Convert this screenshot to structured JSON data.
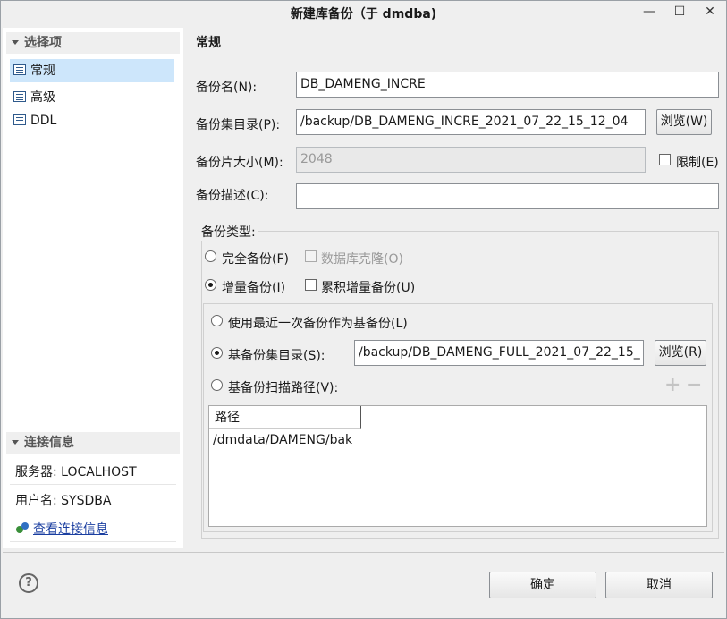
{
  "window": {
    "title": "新建库备份（于 dmdba)"
  },
  "nav": {
    "section_title": "选择项",
    "items": [
      {
        "label": "常规",
        "selected": true
      },
      {
        "label": "高级",
        "selected": false
      },
      {
        "label": "DDL",
        "selected": false
      }
    ]
  },
  "connection": {
    "section_title": "连接信息",
    "server": "服务器: LOCALHOST",
    "user": "用户名: SYSDBA",
    "view_link": "查看连接信息"
  },
  "main": {
    "heading": "常规",
    "backup_name_label": "备份名(N):",
    "backup_name_value": "DB_DAMENG_INCRE",
    "backup_dir_label": "备份集目录(P):",
    "backup_dir_value": "/backup/DB_DAMENG_INCRE_2021_07_22_15_12_04",
    "browse_label": "浏览(W)",
    "piece_size_label": "备份片大小(M):",
    "piece_size_value": "2048",
    "limit_label": "限制(E)",
    "desc_label": "备份描述(C):",
    "desc_value": ""
  },
  "backup_type": {
    "title": "备份类型:",
    "full_label": "完全备份(F)",
    "clone_label": "数据库克隆(O)",
    "incr_label": "增量备份(I)",
    "cumulative_label": "累积增量备份(U)",
    "selected": "incr"
  },
  "incremental": {
    "use_recent_label": "使用最近一次备份作为基备份(L)",
    "base_dir_label": "基备份集目录(S):",
    "base_dir_value": "/backup/DB_DAMENG_FULL_2021_07_22_15_",
    "browse_label": "浏览(R)",
    "scan_path_label": "基备份扫描路径(V):",
    "add_icon": "plus-icon",
    "remove_icon": "minus-icon",
    "column_header": "路径",
    "paths": [
      "/dmdata/DAMENG/bak"
    ]
  },
  "footer": {
    "help_icon": "?",
    "ok_label": "确定",
    "cancel_label": "取消"
  }
}
